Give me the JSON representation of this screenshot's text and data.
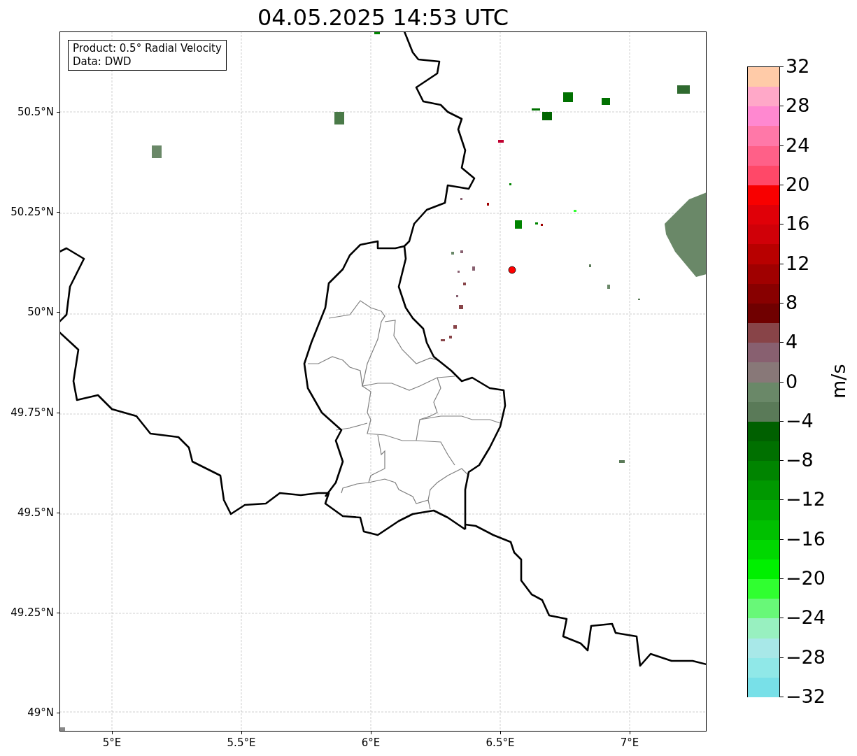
{
  "title": "04.05.2025 14:53 UTC",
  "legend": {
    "lines": [
      "Product: 0.5° Radial Velocity",
      "Data: DWD"
    ]
  },
  "y_axis": {
    "ticks": [
      "50.5°N",
      "50.25°N",
      "50°N",
      "49.75°N",
      "49.5°N",
      "49.25°N",
      "49°N"
    ]
  },
  "x_axis": {
    "ticks": [
      "5°E",
      "5.5°E",
      "6°E",
      "6.5°E",
      "7°E"
    ]
  },
  "colorbar": {
    "label": "m/s",
    "ticks": [
      "32",
      "28",
      "24",
      "20",
      "16",
      "12",
      "8",
      "4",
      "0",
      "−4",
      "−8",
      "−12",
      "−16",
      "−20",
      "−24",
      "−28",
      "−32"
    ],
    "bands": [
      {
        "color": "#ffcba8"
      },
      {
        "color": "#ffa8c8"
      },
      {
        "color": "#ff88d0"
      },
      {
        "color": "#ff78a8"
      },
      {
        "color": "#ff6088"
      },
      {
        "color": "#ff4868"
      },
      {
        "color": "#f80000"
      },
      {
        "color": "#e00008"
      },
      {
        "color": "#d00008"
      },
      {
        "color": "#b80000"
      },
      {
        "color": "#a00000"
      },
      {
        "color": "#880000"
      },
      {
        "color": "#700000"
      },
      {
        "color": "#884448"
      },
      {
        "color": "#886070"
      },
      {
        "color": "#887878"
      },
      {
        "color": "#6a8868"
      },
      {
        "color": "#5a7a58"
      },
      {
        "color": "#006000"
      },
      {
        "color": "#007000"
      },
      {
        "color": "#008400"
      },
      {
        "color": "#009800"
      },
      {
        "color": "#00ac00"
      },
      {
        "color": "#00c000"
      },
      {
        "color": "#00d800"
      },
      {
        "color": "#00f000"
      },
      {
        "color": "#30ff30"
      },
      {
        "color": "#68f878"
      },
      {
        "color": "#98f0c0"
      },
      {
        "color": "#a8e8e8"
      },
      {
        "color": "#90e8e8"
      },
      {
        "color": "#78e0e8"
      }
    ]
  }
}
